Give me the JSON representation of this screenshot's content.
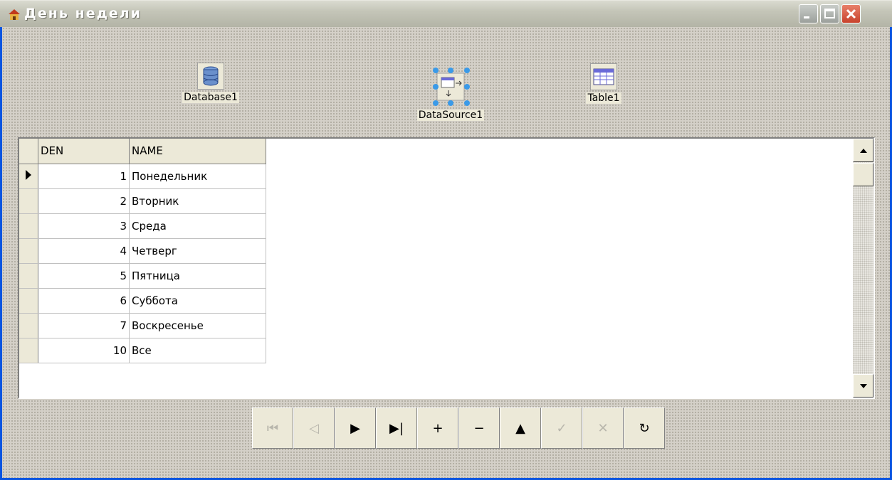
{
  "window": {
    "title": "День недели",
    "accent_color": "#b3b4a6"
  },
  "titlebar_buttons": [
    "minimize-icon",
    "maximize-icon",
    "close-icon"
  ],
  "components": [
    {
      "label": "Database1",
      "icon": "database-icon"
    },
    {
      "label": "DataSource1",
      "icon": "datasource-icon"
    },
    {
      "label": "Table1",
      "icon": "table-icon"
    }
  ],
  "grid": {
    "columns": [
      "DEN",
      "NAME"
    ],
    "rows": [
      {
        "den": "1",
        "name": "Понедельник"
      },
      {
        "den": "2",
        "name": "Вторник"
      },
      {
        "den": "3",
        "name": "Среда"
      },
      {
        "den": "4",
        "name": "Четверг"
      },
      {
        "den": "5",
        "name": "Пятница"
      },
      {
        "den": "6",
        "name": "Суббота"
      },
      {
        "den": "7",
        "name": "Воскресенье"
      },
      {
        "den": "10",
        "name": "Все"
      }
    ],
    "current_row": 0
  },
  "navigator": [
    {
      "name": "nav-first-button",
      "glyph": "⏮",
      "enabled": false
    },
    {
      "name": "nav-prior-button",
      "glyph": "◁",
      "enabled": false
    },
    {
      "name": "nav-next-button",
      "glyph": "▶",
      "enabled": true
    },
    {
      "name": "nav-last-button",
      "glyph": "▶|",
      "enabled": true
    },
    {
      "name": "nav-insert-button",
      "glyph": "+",
      "enabled": true
    },
    {
      "name": "nav-delete-button",
      "glyph": "−",
      "enabled": true
    },
    {
      "name": "nav-edit-button",
      "glyph": "▲",
      "enabled": true
    },
    {
      "name": "nav-post-button",
      "glyph": "✓",
      "enabled": false
    },
    {
      "name": "nav-cancel-button",
      "glyph": "✕",
      "enabled": false
    },
    {
      "name": "nav-refresh-button",
      "glyph": "↻",
      "enabled": true
    }
  ]
}
